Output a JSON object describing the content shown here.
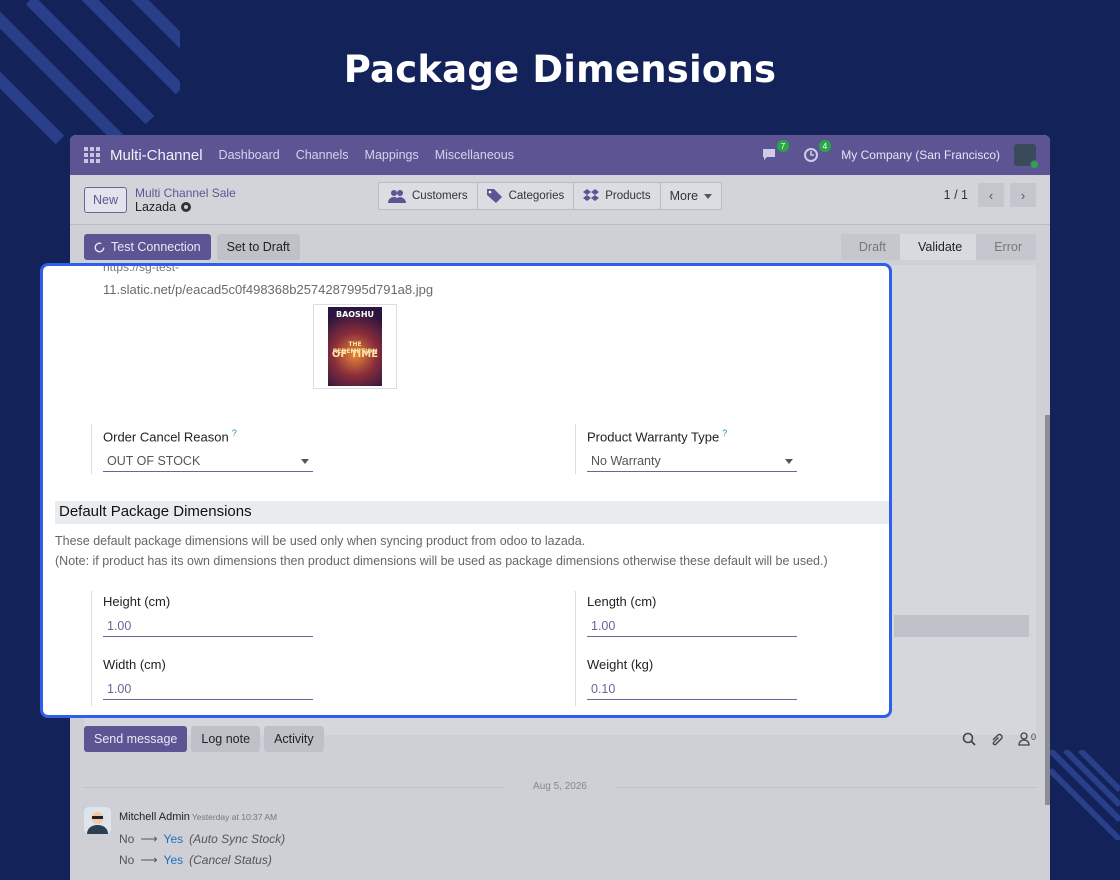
{
  "page_heading": "Package Dimensions",
  "navbar": {
    "brand": "Multi-Channel",
    "menu": [
      "Dashboard",
      "Channels",
      "Mappings",
      "Miscellaneous"
    ],
    "messages_badge": "7",
    "activity_badge": "4",
    "company": "My Company (San Francisco)"
  },
  "control_panel": {
    "new_label": "New",
    "breadcrumb_parent": "Multi Channel Sale",
    "breadcrumb_current": "Lazada",
    "smart_buttons": [
      "Customers",
      "Categories",
      "Products",
      "More"
    ],
    "pager": "1 / 1"
  },
  "actions": {
    "test_connection": "Test Connection",
    "set_to_draft": "Set to Draft"
  },
  "statusbar": [
    "Draft",
    "Validate",
    "Error"
  ],
  "modal": {
    "url_cut": "https://sg-test-",
    "url": "11.slatic.net/p/eacad5c0f498368b2574287995d791a8.jpg",
    "book_author": "BAOSHU",
    "book_title_small": "THE REDEMPTION",
    "book_title_big": "OF TIME",
    "order_cancel_reason": {
      "label": "Order Cancel Reason",
      "help": "?",
      "value": "OUT OF STOCK"
    },
    "product_warranty_type": {
      "label": "Product Warranty Type",
      "help": "?",
      "value": "No Warranty"
    },
    "section_title": "Default Package Dimensions",
    "help_line1": "These default package dimensions will be used only when syncing product from odoo to lazada.",
    "help_line2": "(Note: if product has its own dimensions then product dimensions will be used as package dimensions otherwise these default will be used.)",
    "height": {
      "label": "Height (cm)",
      "value": "1.00"
    },
    "length": {
      "label": "Length (cm)",
      "value": "1.00"
    },
    "width": {
      "label": "Width (cm)",
      "value": "1.00"
    },
    "weight": {
      "label": "Weight (kg)",
      "value": "0.10"
    }
  },
  "chatter": {
    "send_message": "Send message",
    "log_note": "Log note",
    "activity": "Activity",
    "followers_count": "0",
    "date": "Aug 5, 2026",
    "author": "Mitchell Admin",
    "time": "Yesterday at 10:37 AM",
    "changes": [
      {
        "old": "No",
        "new": "Yes",
        "field": "(Auto Sync Stock)"
      },
      {
        "old": "No",
        "new": "Yes",
        "field": "(Cancel Status)"
      }
    ]
  },
  "colors": {
    "background": "#14225a",
    "navbar": "#5d5593",
    "modal_border": "#2f5ee8",
    "link": "#1f6fb2"
  }
}
